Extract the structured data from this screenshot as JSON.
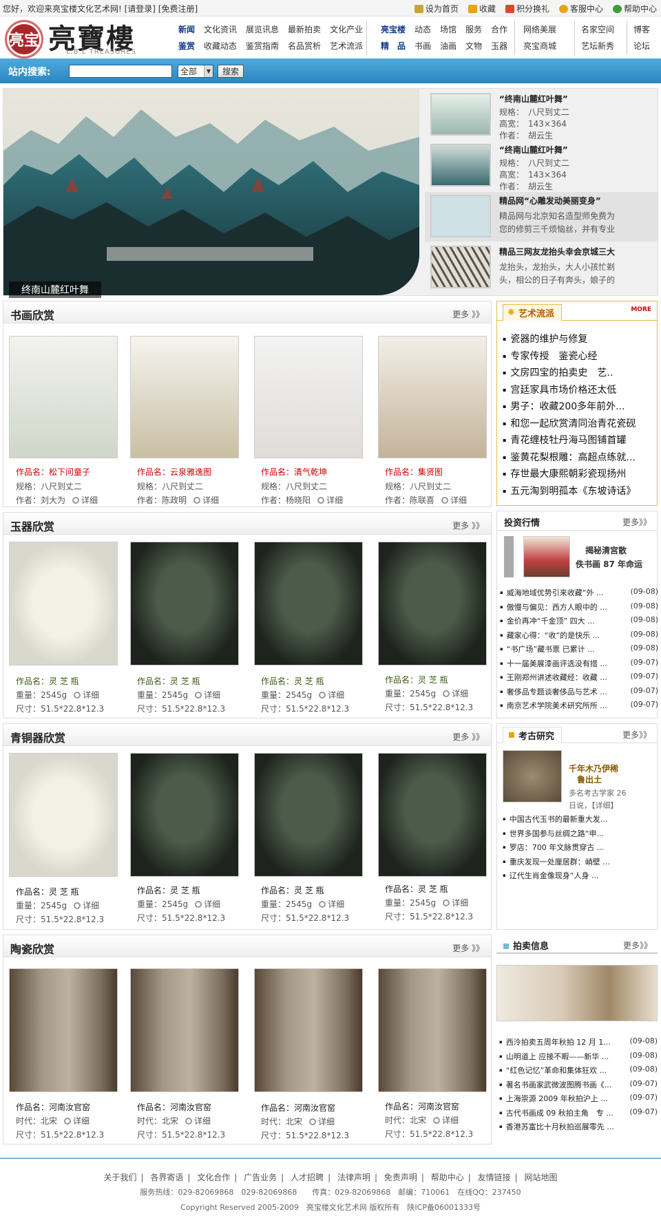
{
  "topbar": {
    "welcome": "您好，欢迎来亮宝楼文化艺术网! [请登录] [免费注册]",
    "links": [
      {
        "label": "设为首页",
        "color": "#c9a23a"
      },
      {
        "label": "收藏",
        "color": "#e8a317"
      },
      {
        "label": "积分换礼",
        "color": "#d9482b"
      },
      {
        "label": "客服中心",
        "color": "#e8a317"
      },
      {
        "label": "帮助中心",
        "color": "#3a9d3a"
      }
    ]
  },
  "logo": {
    "seal": "亮宝",
    "name": "亮寶樓",
    "sub": "L.B.L TREASURES"
  },
  "nav": {
    "g1r1": [
      "新闻",
      "文化资讯",
      "展览讯息",
      "最新拍卖",
      "文化产业"
    ],
    "g1r2": [
      "鉴赏",
      "收藏动态",
      "鉴赏指南",
      "名品赏析",
      "艺术流派"
    ],
    "g2r1": [
      "亮宝楼",
      "动态",
      "场馆",
      "服务",
      "合作"
    ],
    "g2r2": [
      "精　品",
      "书画",
      "油画",
      "文物",
      "玉器"
    ],
    "g3r1": "网络美展",
    "g3r2": "亮宝商城",
    "g4r1": "名家空间",
    "g4r2": "艺坛新秀",
    "g5r1": "博客",
    "g5r2": "论坛"
  },
  "search": {
    "label": "站内搜索:",
    "value": "",
    "select": "全部",
    "button": "搜索"
  },
  "banner": {
    "caption": "终南山麓红叶舞",
    "items": [
      {
        "title": "“终南山麓红叶舞”",
        "l1": "规格：　八尺到丈二",
        "l2": "高宽：　143×364",
        "l3": "作者：　胡云生"
      },
      {
        "title": "“终南山麓红叶舞”",
        "l1": "规格：　八尺到丈二",
        "l2": "高宽：　143×364",
        "l3": "作者：　胡云生"
      },
      {
        "title": "精品网“心雕发动美丽变身”",
        "l1": "精品网与北京知名造型师免费为",
        "l2": "您的修剪三千烦恼丝，并有专业"
      },
      {
        "title": "精品三网友龙抬头幸会京城三大",
        "l1": "龙抬头，龙抬头，大人小孩忙剃",
        "l2": "头，相公的日子有奔头，娘子的"
      }
    ]
  },
  "shuhua": {
    "title": "书画欣赏",
    "more": "更多 》》",
    "items": [
      {
        "name": "作品名：松下问童子",
        "spec": "规格：八尺到丈二",
        "author": "作者：刘大为",
        "detail": "详细"
      },
      {
        "name": "作品名：云泉雅逸图",
        "spec": "规格：八尺到丈二",
        "author": "作者：陈政明",
        "detail": "详细"
      },
      {
        "name": "作品名：清气乾坤",
        "spec": "规格：八尺到丈二",
        "author": "作者：杨晓阳",
        "detail": "详细"
      },
      {
        "name": "作品名：集贤图",
        "spec": "规格：八尺到丈二",
        "author": "作者：陈联喜",
        "detail": "详细"
      }
    ]
  },
  "yuqi": {
    "title": "玉器欣赏",
    "more": "更多 》》",
    "items": [
      {
        "name": "作品名：灵 芝 瓶",
        "weight": "重量：2545g",
        "size": "尺寸：51.5*22.8*12.3",
        "detail": "详细"
      },
      {
        "name": "作品名：灵 芝 瓶",
        "weight": "重量：2545g",
        "size": "尺寸：51.5*22.8*12.3",
        "detail": "详细"
      },
      {
        "name": "作品名：灵 芝 瓶",
        "weight": "重量：2545g",
        "size": "尺寸：51.5*22.8*12.3",
        "detail": "详细"
      },
      {
        "name": "作品名：灵 芝 瓶",
        "weight": "重量：2545g",
        "size": "尺寸：51.5*22.8*12.3",
        "detail": "详细"
      }
    ]
  },
  "qingtong": {
    "title": "青铜器欣赏",
    "more": "更多 》》",
    "items": [
      {
        "name": "作品名：灵 芝 瓶",
        "weight": "重量：2545g",
        "size": "尺寸：51.5*22.8*12.3",
        "detail": "详细"
      },
      {
        "name": "作品名：灵 芝 瓶",
        "weight": "重量：2545g",
        "size": "尺寸：51.5*22.8*12.3",
        "detail": "详细"
      },
      {
        "name": "作品名：灵 芝 瓶",
        "weight": "重量：2545g",
        "size": "尺寸：51.5*22.8*12.3",
        "detail": "详细"
      },
      {
        "name": "作品名：灵 芝 瓶",
        "weight": "重量：2545g",
        "size": "尺寸：51.5*22.8*12.3",
        "detail": "详细"
      }
    ]
  },
  "taoci": {
    "title": "陶瓷欣赏",
    "more": "更多 》》",
    "items": [
      {
        "name": "作品名：河南汝官窑",
        "era": "时代：北宋",
        "size": "尺寸：51.5*22.8*12.3",
        "detail": "详细"
      },
      {
        "name": "作品名：河南汝官窑",
        "era": "时代：北宋",
        "size": "尺寸：51.5*22.8*12.3",
        "detail": "详细"
      },
      {
        "name": "作品名：河南汝官窑",
        "era": "时代：北宋",
        "size": "尺寸：51.5*22.8*12.3",
        "detail": "详细"
      },
      {
        "name": "作品名：河南汝官窑",
        "era": "时代：北宋",
        "size": "尺寸：51.5*22.8*12.3",
        "detail": "详细"
      }
    ]
  },
  "yishu": {
    "title": "艺术流派",
    "more": "MORE",
    "items": [
      "瓷器的维护与修复",
      "专家传授　鉴瓷心经",
      "文房四宝的拍卖史　艺..",
      "宫廷家具市场价格还太低",
      "男子：收藏200多年前外...",
      "和您一起欣赏清同治青花瓷砚",
      "青花缠枝牡丹海马图铺首罐",
      "鉴黄花梨根雕：高超点练就...",
      "存世最大康熙朝彩瓷现扬州",
      "五元淘到明孤本《东坡诗话》"
    ]
  },
  "touzi": {
    "title": "投资行情",
    "more": "更多》》",
    "feat_l1": "揭秘清宫散",
    "feat_l2": "佚书画 87 年命运",
    "items": [
      {
        "t": "威海地域优势引来收藏“外 ...",
        "d": "(09-08)"
      },
      {
        "t": "傲慢与偏见：西方人眼中的 ...",
        "d": "(09-08)"
      },
      {
        "t": "金价再冲“千金顶” 四大 ...",
        "d": "(09-08)"
      },
      {
        "t": "藏家心得：“收”的是快乐 ...",
        "d": "(09-08)"
      },
      {
        "t": "“书广场”藏书票 已累计 ...",
        "d": "(09-08)"
      },
      {
        "t": "十一届美展漆画评选没有措 ...",
        "d": "(09-07)"
      },
      {
        "t": "王刚郑州讲述收藏经：收藏 ...",
        "d": "(09-07)"
      },
      {
        "t": "奢侈品专题谈奢侈品与艺术 ...",
        "d": "(09-07)"
      },
      {
        "t": "南京艺术学院美术研究所所 ...",
        "d": "(09-07)"
      }
    ]
  },
  "kaogu": {
    "title": "考古研究",
    "more": "更多》》",
    "feat_t1": "千年木乃伊稀",
    "feat_t2": "鲁出土",
    "feat_d1": "多名考古学家 26",
    "feat_d2": "日说，【详细】",
    "items": [
      "中国古代玉书的最新重大发...",
      "世界多国参与丝绸之路“申...",
      "罗店：700 年文脉贯穿古 ...",
      "重庆发现一处厘居群：峭壁 ...",
      "辽代生肖金像现身“人身 ..."
    ]
  },
  "paimai": {
    "title": "拍卖信息",
    "more": "更多》》",
    "items": [
      {
        "t": "西泠拍卖五周年秋拍 12 月 1...",
        "d": "(09-08)"
      },
      {
        "t": "山明道上 应接不暇——新华 ...",
        "d": "(09-08)"
      },
      {
        "t": "“红色记忆”革命和集体狂欢 ...",
        "d": "(09-08)"
      },
      {
        "t": "著名书画家武微波图腾书画《...",
        "d": "(09-07)"
      },
      {
        "t": "上海崇源 2009 年秋拍沪上 ...",
        "d": "(09-07)"
      },
      {
        "t": "古代书画成 09 秋拍主角　专 ...",
        "d": "(09-07)"
      },
      {
        "t": "香港苏富比十月秋拍巡展零先 ...",
        "d": ""
      }
    ]
  },
  "footer": {
    "links": [
      "关于我们",
      "各界寄语",
      "文化合作",
      "广告业务",
      "人才招聘",
      "法律声明",
      "免责声明",
      "帮助中心",
      "友情链接",
      "网站地图"
    ],
    "contact": "服务热线：029-82069868　029-82069868　　传真：029-82069868　邮编：710061　在线QQ：237450",
    "copy": "Copyright Reserved 2005-2009　亮宝楼文化艺术网 版权所有　陕ICP备06001333号"
  }
}
